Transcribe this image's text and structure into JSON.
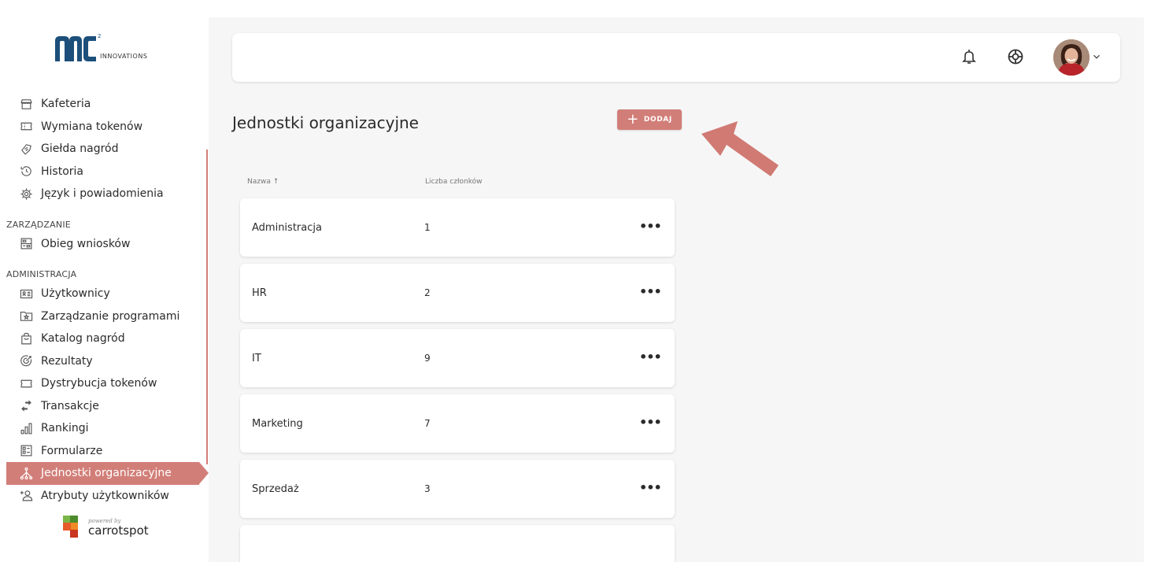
{
  "brand": {
    "logo_text": "INNOVATIONS",
    "logo_sup": "2",
    "logo_color": "#1c4f7a",
    "accent_color": "#d27e78"
  },
  "sidebar": {
    "items_top": [
      {
        "label": "Kafeteria",
        "icon": "store-icon"
      },
      {
        "label": "Wymiana tokenów",
        "icon": "ticket-icon"
      },
      {
        "label": "Giełda nagród",
        "icon": "handshake-icon"
      },
      {
        "label": "Historia",
        "icon": "history-icon"
      },
      {
        "label": "Język i powiadomienia",
        "icon": "settings-icon"
      }
    ],
    "section_management": "ZARZĄDZANIE",
    "items_management": [
      {
        "label": "Obieg wniosków",
        "icon": "workflow-icon"
      }
    ],
    "section_admin": "ADMINISTRACJA",
    "items_admin": [
      {
        "label": "Użytkownicy",
        "icon": "id-card-icon"
      },
      {
        "label": "Zarządzanie programami",
        "icon": "folder-star-icon"
      },
      {
        "label": "Katalog nagród",
        "icon": "shopping-bag-icon"
      },
      {
        "label": "Rezultaty",
        "icon": "target-icon"
      },
      {
        "label": "Dystrybucja tokenów",
        "icon": "ticket-icon"
      },
      {
        "label": "Transakcje",
        "icon": "swap-arrows-icon"
      },
      {
        "label": "Rankingi",
        "icon": "bar-chart-icon"
      },
      {
        "label": "Formularze",
        "icon": "form-icon"
      },
      {
        "label": "Jednostki organizacyjne",
        "icon": "org-tree-icon",
        "active": true
      },
      {
        "label": "Atrybuty użytkowników",
        "icon": "user-attributes-icon"
      }
    ],
    "powered_by": "powered by",
    "powered_brand": "carrotspot"
  },
  "topbar": {
    "bell_icon": "bell-icon",
    "help_icon": "lifebuoy-icon",
    "avatar": "user-avatar",
    "menu_icon": "chevron-down-icon"
  },
  "page": {
    "title": "Jednostki organizacyjne",
    "add_label": "DODAJ",
    "columns": {
      "name": "Nazwa ↑",
      "members": "Liczba członków"
    },
    "rows": [
      {
        "name": "Administracja",
        "count": "1"
      },
      {
        "name": "HR",
        "count": "2"
      },
      {
        "name": "IT",
        "count": "9"
      },
      {
        "name": "Marketing",
        "count": "7"
      },
      {
        "name": "Sprzedaż",
        "count": "3"
      },
      {
        "name": "",
        "count": ""
      }
    ],
    "more_label": "•••"
  }
}
